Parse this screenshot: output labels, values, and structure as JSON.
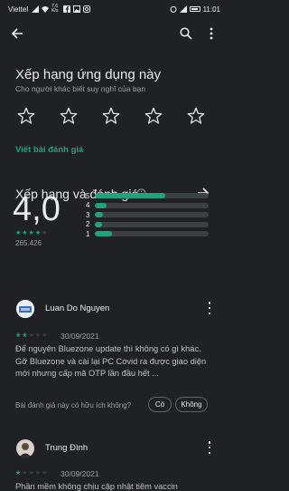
{
  "status_bar": {
    "carrier": "Viettel",
    "speed": "7,6 K/s",
    "time": "11:01"
  },
  "rate_app": {
    "title": "Xếp hạng ứng dụng này",
    "subtitle": "Cho người khác biết suy nghĩ của bạn",
    "write_review": "Viết bài đánh giá"
  },
  "ratings": {
    "title": "Xếp hạng và đánh giá",
    "score": "4,0",
    "count": "265.426",
    "distribution": [
      {
        "star": "5",
        "fraction": 0.62
      },
      {
        "star": "4",
        "fraction": 0.1
      },
      {
        "star": "3",
        "fraction": 0.07
      },
      {
        "star": "2",
        "fraction": 0.06
      },
      {
        "star": "1",
        "fraction": 0.15
      }
    ]
  },
  "reviews": [
    {
      "name": "Luan Do Nguyen",
      "stars": 2,
      "date": "30/09/2021",
      "text": "Để nguyên Bluezone update thì không có gì khác. Gỡ Bluezone và cài lại PC Covid ra được giao diện mới nhưng cấp mã OTP lần đầu hết ...",
      "helpful_question": "Bài đánh giá này có hữu ích không?",
      "yes": "Có",
      "no": "Không"
    },
    {
      "name": "Trung Đình",
      "stars": 1,
      "date": "30/09/2021",
      "text": "Phần mềm không chịu cập nhật tiêm vaccin"
    }
  ],
  "colors": {
    "accent": "#1fa37a",
    "background": "#202124"
  }
}
